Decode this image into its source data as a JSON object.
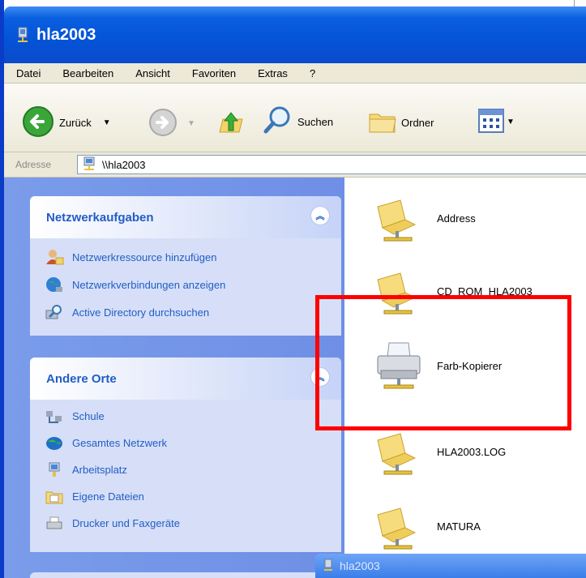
{
  "window": {
    "title": "hla2003"
  },
  "menu": [
    "Datei",
    "Bearbeiten",
    "Ansicht",
    "Favoriten",
    "Extras",
    "?"
  ],
  "toolbar": {
    "back_label": "Zurück",
    "search_label": "Suchen",
    "folders_label": "Ordner"
  },
  "address": {
    "label": "Adresse",
    "value": "\\\\hla2003"
  },
  "tasks": {
    "title": "Netzwerkaufgaben",
    "items": [
      "Netzwerkressource hinzufügen",
      "Netzwerkverbindungen anzeigen",
      "Active Directory durchsuchen"
    ]
  },
  "places": {
    "title": "Andere Orte",
    "items": [
      "Schule",
      "Gesamtes Netzwerk",
      "Arbeitsplatz",
      "Eigene Dateien",
      "Drucker und Faxgeräte"
    ]
  },
  "files": [
    {
      "name": "Address",
      "type": "share"
    },
    {
      "name": "CD_ROM_HLA2003",
      "type": "share"
    },
    {
      "name": "Farb-Kopierer",
      "type": "printer"
    },
    {
      "name": "HLA2003.LOG",
      "type": "share"
    },
    {
      "name": "MATURA",
      "type": "share"
    }
  ],
  "taskbar_window": {
    "title": "hla2003"
  },
  "colors": {
    "highlight": "#ff0000",
    "titlebar": "#0553d6",
    "link": "#215dc6"
  }
}
